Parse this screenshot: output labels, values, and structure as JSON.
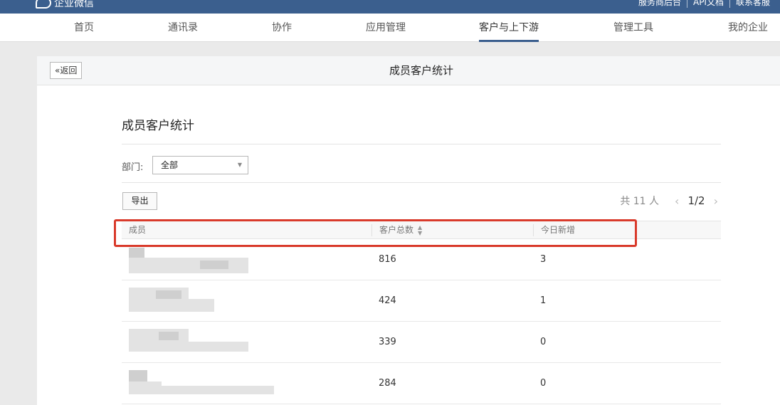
{
  "header": {
    "logo_text": "企业微信",
    "links": [
      "服务商后台",
      "API文档",
      "联系客服"
    ]
  },
  "nav": {
    "items": [
      "首页",
      "通讯录",
      "协作",
      "应用管理",
      "客户与上下游",
      "管理工具",
      "我的企业"
    ],
    "active_index": 4
  },
  "panel": {
    "back_label": "«返回",
    "title": "成员客户统计"
  },
  "content": {
    "section_title": "成员客户统计",
    "dept_label": "部门:",
    "dept_value": "全部",
    "export_label": "导出",
    "pager": {
      "total": "共 11 人",
      "page": "1/2",
      "prev": "‹",
      "next": "›"
    }
  },
  "table": {
    "columns": [
      "成员",
      "客户总数",
      "今日新增"
    ],
    "rows": [
      {
        "total": "816",
        "new_today": "3"
      },
      {
        "total": "424",
        "new_today": "1"
      },
      {
        "total": "339",
        "new_today": "0"
      },
      {
        "total": "284",
        "new_today": "0"
      }
    ]
  },
  "colors": {
    "brand": "#3b5f8e",
    "highlight": "#d93a2b"
  }
}
